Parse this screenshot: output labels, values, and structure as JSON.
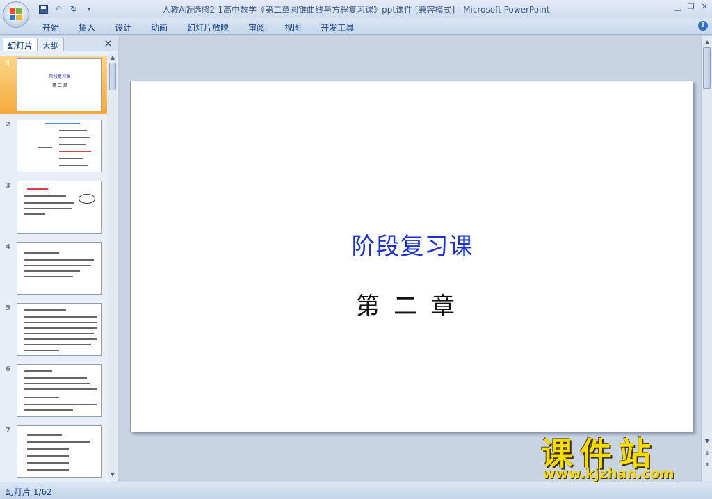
{
  "window": {
    "title": "人教A版选修2-1高中数学《第二章圆锥曲线与方程复习课》ppt课件 [兼容模式] - Microsoft PowerPoint"
  },
  "ribbon": {
    "tabs": [
      "开始",
      "插入",
      "设计",
      "动画",
      "幻灯片放映",
      "审阅",
      "视图",
      "开发工具"
    ]
  },
  "left_pane": {
    "tab_slides": "幻灯片",
    "tab_outline": "大纲",
    "thumbnails": [
      {
        "num": "1",
        "selected": true
      },
      {
        "num": "2",
        "selected": false
      },
      {
        "num": "3",
        "selected": false
      },
      {
        "num": "4",
        "selected": false
      },
      {
        "num": "5",
        "selected": false
      },
      {
        "num": "6",
        "selected": false
      },
      {
        "num": "7",
        "selected": false
      }
    ],
    "thumb1_title": "阶段复习课",
    "thumb1_sub": "第 二 章"
  },
  "slide": {
    "title": "阶段复习课",
    "subtitle": "第二章"
  },
  "status": {
    "slide_indicator": "幻灯片 1/62"
  },
  "watermark": {
    "title": "课件站",
    "url": "www.kjzhan.com"
  },
  "colors": {
    "slide_title": "#1b2fd6",
    "selected_thumb": "#f4a93c",
    "watermark": "#f5dc00"
  }
}
